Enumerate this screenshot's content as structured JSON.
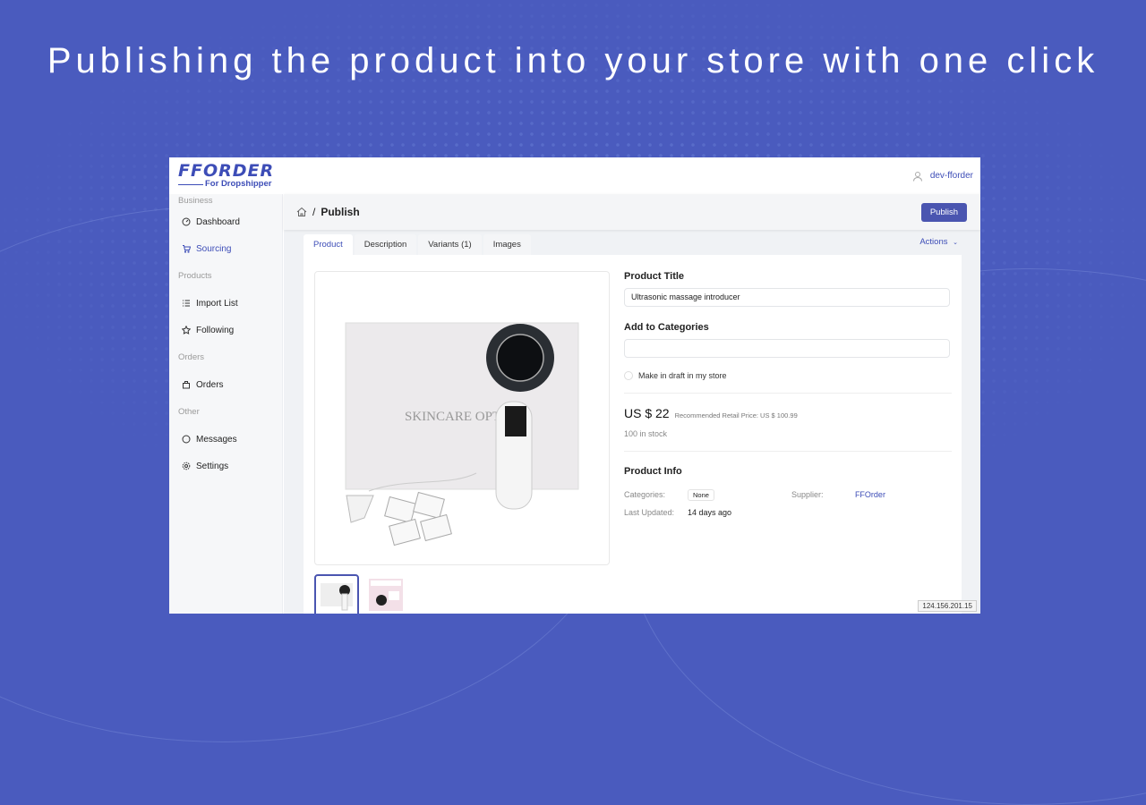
{
  "headline": "Publishing the product into your store with one click",
  "app": {
    "logo": {
      "main": "FFORDER",
      "sub": "For Dropshipper"
    },
    "user": {
      "name": "dev-fforder"
    },
    "sidebar": {
      "sections": [
        {
          "title": "Business",
          "items": [
            {
              "label": "Dashboard",
              "icon": "dashboard-icon"
            },
            {
              "label": "Sourcing",
              "icon": "cart-icon",
              "active": true
            }
          ]
        },
        {
          "title": "Products",
          "items": [
            {
              "label": "Import List",
              "icon": "list-icon"
            },
            {
              "label": "Following",
              "icon": "star-icon"
            }
          ]
        },
        {
          "title": "Orders",
          "items": [
            {
              "label": "Orders",
              "icon": "bag-icon"
            }
          ]
        },
        {
          "title": "Other",
          "items": [
            {
              "label": "Messages",
              "icon": "message-icon"
            },
            {
              "label": "Settings",
              "icon": "gear-icon"
            }
          ]
        }
      ]
    },
    "breadcrumb": {
      "separator": "/",
      "current": "Publish"
    },
    "publish_button": "Publish",
    "tabs": [
      {
        "label": "Product",
        "active": true
      },
      {
        "label": "Description"
      },
      {
        "label": "Variants (1)"
      },
      {
        "label": "Images"
      }
    ],
    "actions_label": "Actions",
    "form": {
      "title_label": "Product Title",
      "title_value": "Ultrasonic massage introducer",
      "categories_label": "Add to Categories",
      "categories_value": "",
      "draft_label": "Make in draft in my store",
      "price": "US $ 22",
      "retail_price": "Recommended Retail Price: US $ 100.99",
      "stock": "100 in stock",
      "info_title": "Product Info",
      "categories_key": "Categories:",
      "categories_tag": "None",
      "supplier_key": "Supplier:",
      "supplier_value": "FFOrder",
      "updated_key": "Last Updated:",
      "updated_value": "14 days ago"
    },
    "product_image_text": "SKINCARE OPTIC",
    "ip_badge": "124.156.201.15"
  },
  "colors": {
    "background": "#4a5bbe",
    "accent": "#3d4db7",
    "button": "#4a55b0"
  }
}
